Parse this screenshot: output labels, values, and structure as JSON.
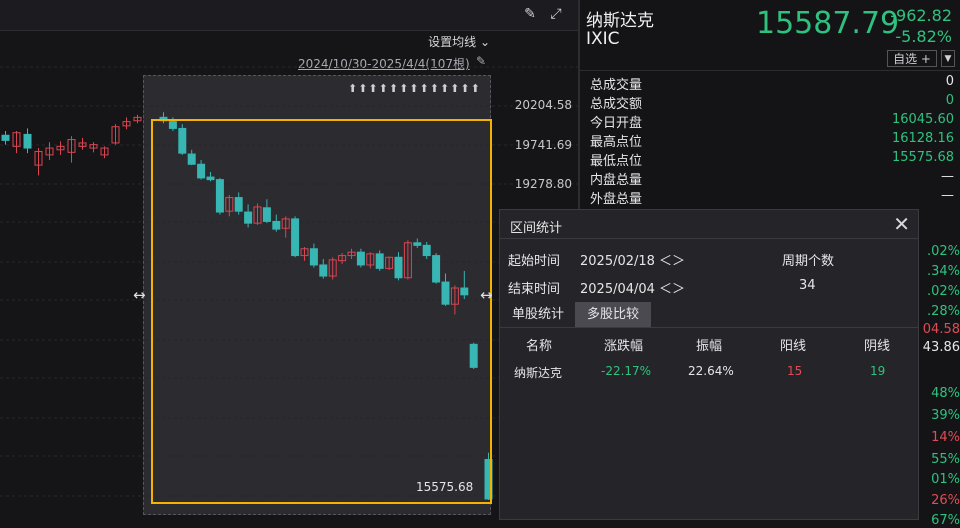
{
  "toolbar": {
    "draw_icon": "pen-icon",
    "fullscreen_icon": "fullscreen-icon",
    "ma_setting": "设置均线",
    "ma_caret": "⌄"
  },
  "range": {
    "text": "2024/10/30-2025/4/4(107根)",
    "pin_icon": "pin-icon"
  },
  "y_axis": {
    "labels": [
      "20204.58",
      "19741.69",
      "19278.80"
    ]
  },
  "selection": {
    "arrows": "⬆⬆⬆⬆⬆⬆⬆⬆⬆⬆⬆⬆⬆",
    "last_price": "15575.68",
    "handle_glyph": "↔"
  },
  "chart_data": {
    "type": "candlestick",
    "y_axis_ticks": [
      20204.58,
      19741.69,
      19278.8
    ],
    "range_low": 15575.68,
    "up_color": "#d94550",
    "down_color": "#37b6b3",
    "candles_approx": [
      {
        "o": 19850,
        "h": 19900,
        "l": 19740,
        "c": 19790,
        "dir": "down"
      },
      {
        "o": 19720,
        "h": 19900,
        "l": 19640,
        "c": 19880,
        "dir": "up"
      },
      {
        "o": 19860,
        "h": 19930,
        "l": 19640,
        "c": 19700,
        "dir": "down"
      },
      {
        "o": 19500,
        "h": 19700,
        "l": 19380,
        "c": 19660,
        "dir": "up"
      },
      {
        "o": 19620,
        "h": 19770,
        "l": 19560,
        "c": 19700,
        "dir": "up"
      },
      {
        "o": 19680,
        "h": 19780,
        "l": 19620,
        "c": 19720,
        "dir": "up"
      },
      {
        "o": 19650,
        "h": 19840,
        "l": 19530,
        "c": 19800,
        "dir": "up"
      },
      {
        "o": 19720,
        "h": 19820,
        "l": 19680,
        "c": 19760,
        "dir": "up"
      },
      {
        "o": 19700,
        "h": 19770,
        "l": 19650,
        "c": 19740,
        "dir": "up"
      },
      {
        "o": 19620,
        "h": 19720,
        "l": 19580,
        "c": 19700,
        "dir": "up"
      },
      {
        "o": 19760,
        "h": 19980,
        "l": 19740,
        "c": 19950,
        "dir": "up"
      },
      {
        "o": 19960,
        "h": 20060,
        "l": 19920,
        "c": 20010,
        "dir": "up"
      },
      {
        "o": 20020,
        "h": 20090,
        "l": 19990,
        "c": 20060,
        "dir": "up"
      }
    ]
  },
  "quote": {
    "name": "纳斯达克",
    "code": "IXIC",
    "price": "15587.79",
    "change": "-962.82",
    "change_pct": "-5.82%",
    "watch": "自选 +",
    "watch_more": "▼"
  },
  "stats": [
    {
      "label": "总成交量",
      "value": "0"
    },
    {
      "label": "总成交额",
      "value": "0"
    },
    {
      "label": "今日开盘",
      "value": "16045.60"
    },
    {
      "label": "最高点位",
      "value": "16128.16"
    },
    {
      "label": "最低点位",
      "value": "15575.68"
    },
    {
      "label": "内盘总量",
      "value": "—"
    },
    {
      "label": "外盘总量",
      "value": "—"
    }
  ],
  "side_pcts": [
    {
      "text": ".02%",
      "color": "#2ec27e"
    },
    {
      "text": ".34%",
      "color": "#2ec27e"
    },
    {
      "text": ".02%",
      "color": "#2ec27e"
    },
    {
      "text": ".28%",
      "color": "#2ec27e"
    },
    {
      "text": "04.58",
      "color": "#e04b55"
    },
    {
      "text": "43.86",
      "color": "#e6e6e8"
    },
    {
      "text": "48%",
      "color": "#2ec27e"
    },
    {
      "text": "39%",
      "color": "#2ec27e"
    },
    {
      "text": "14%",
      "color": "#e04b55"
    },
    {
      "text": "55%",
      "color": "#2ec27e"
    },
    {
      "text": "01%",
      "color": "#2ec27e"
    },
    {
      "text": "26%",
      "color": "#e04b55"
    },
    {
      "text": "67%",
      "color": "#2ec27e"
    }
  ],
  "dialog": {
    "title": "区间统计",
    "close": "✕",
    "start_label": "起始时间",
    "start_value": "2025/02/18 ＜＞",
    "end_label": "结束时间",
    "end_value": "2025/04/04 ＜＞",
    "period_label": "周期个数",
    "period_value": "34",
    "tabs": [
      "单股统计",
      "多股比较"
    ],
    "headers": [
      "名称",
      "涨跌幅",
      "振幅",
      "阳线",
      "阴线"
    ],
    "row": {
      "name": "纳斯达克",
      "change_pct": "-22.17%",
      "amplitude": "22.64%",
      "up": "15",
      "down": "19"
    }
  }
}
